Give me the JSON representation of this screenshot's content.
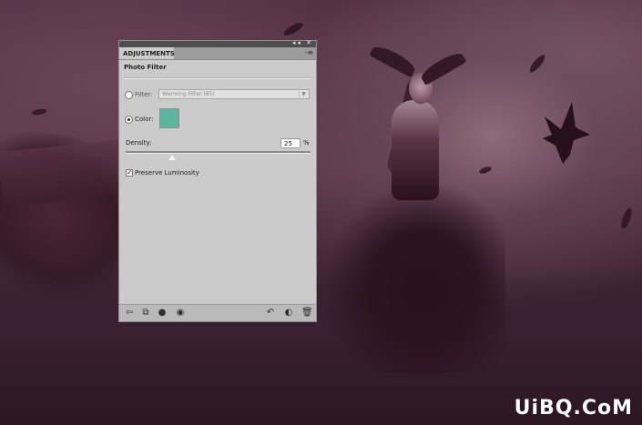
{
  "panel": {
    "tab_label": "ADJUSTMENTS",
    "title": "Photo Filter",
    "filter": {
      "label": "Filter:",
      "selected": "Warming Filter (85)",
      "checked": false
    },
    "color": {
      "label": "Color:",
      "checked": true,
      "swatch": "#5bb69f"
    },
    "density": {
      "label": "Density:",
      "value": "25",
      "unit": "%",
      "level_percent": 25
    },
    "preserve": {
      "label": "Preserve Luminosity",
      "checked": true
    },
    "window_controls": "◂◂ ✕",
    "menu_icon": "-≡",
    "footer_icons": [
      "return-arrow-icon",
      "clip-to-layer-icon",
      "visibility-eye-icon",
      "view-previous-state-icon",
      "reset-icon",
      "toggle-visibility-icon",
      "delete-trash-icon"
    ]
  },
  "watermark": "UiBQ.CoM",
  "colors": {
    "panel_bg": "#cbcbcb",
    "swatch": "#5bb69f",
    "background_tint": "#3e2433"
  }
}
